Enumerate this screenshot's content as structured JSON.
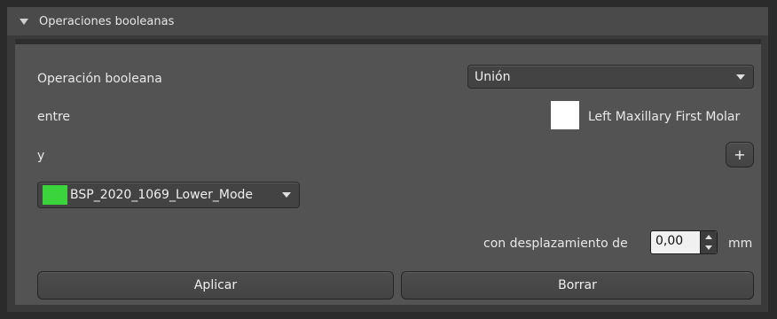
{
  "panel": {
    "title": "Operaciones booleanas"
  },
  "operation": {
    "label": "Operación booleana",
    "selected": "Unión"
  },
  "between": {
    "label": "entre",
    "object_name": "Left Maxillary First Molar",
    "swatch_color": "#ffffff"
  },
  "and": {
    "label": "y",
    "add_icon": "plus-icon",
    "add_label": "+",
    "object_name": "BSP_2020_1069_Lower_Mode",
    "swatch_color": "#3cd43c"
  },
  "offset": {
    "label": "con desplazamiento de",
    "value": "0,00",
    "unit": "mm"
  },
  "actions": {
    "apply_label": "Aplicar",
    "clear_label": "Borrar"
  },
  "colors": {
    "background": "#2b2b2b",
    "header": "#4a4a4a",
    "body": "#535353"
  }
}
